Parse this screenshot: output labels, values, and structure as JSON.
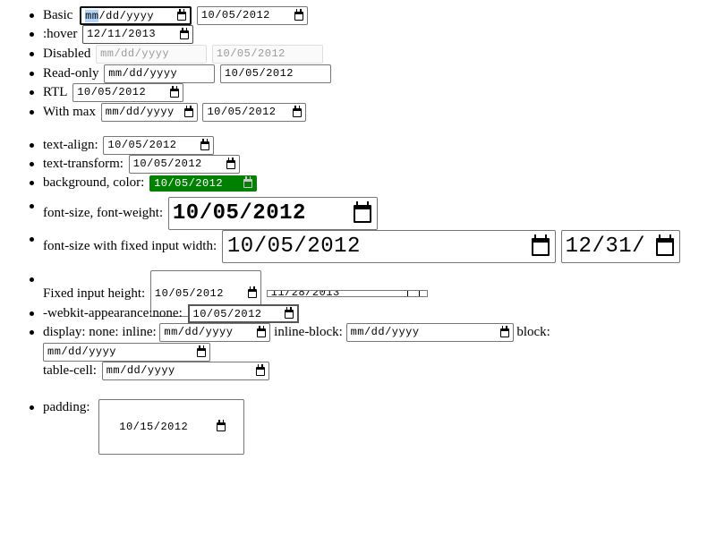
{
  "items": {
    "basic": {
      "label": "Basic",
      "input1": {
        "mm": "mm",
        "rest": "/dd/yyyy"
      },
      "input2": "10/05/2012"
    },
    "hover": {
      "label": ":hover",
      "input1": "12/11/2013"
    },
    "disabled": {
      "label": "Disabled",
      "input1": "mm/dd/yyyy",
      "input2": "10/05/2012"
    },
    "readonly": {
      "label": "Read-only",
      "input1": "mm/dd/yyyy",
      "input2": "10/05/2012"
    },
    "rtl": {
      "label": "RTL",
      "input1": "10/05/2012"
    },
    "withmax": {
      "label": "With max",
      "input1": "mm/dd/yyyy",
      "input2": "10/05/2012"
    },
    "textalign": {
      "label": "text-align:",
      "input1": "10/05/2012"
    },
    "texttransform": {
      "label": "text-transform:",
      "input1": "10/05/2012"
    },
    "bgcolor": {
      "label": "background, color:",
      "input1": "10/05/2012",
      "bg": "#008000",
      "fg": "#ffffff"
    },
    "fontsize": {
      "label": "font-size, font-weight:",
      "input1": "10/05/2012"
    },
    "fixedwidth": {
      "label": "font-size with fixed input width:",
      "input1": "10/05/2012",
      "input2": "12/31/"
    },
    "fixedheight": {
      "label": "Fixed input height:",
      "input1": "10/05/2012",
      "input2": "11/28/2013"
    },
    "appearance": {
      "label": "-webkit-appearance:none:",
      "input1": "10/05/2012"
    },
    "display": {
      "label": "display: none: inline:",
      "input1": "mm/dd/yyyy",
      "inlineblock_label": "inline-block:",
      "input2": "mm/dd/yyyy",
      "block_label": "block:",
      "input3": "mm/dd/yyyy",
      "tablecell_label": "table-cell:",
      "input4": "mm/dd/yyyy"
    },
    "padding": {
      "label": "padding:",
      "input1": "10/15/2012"
    }
  }
}
